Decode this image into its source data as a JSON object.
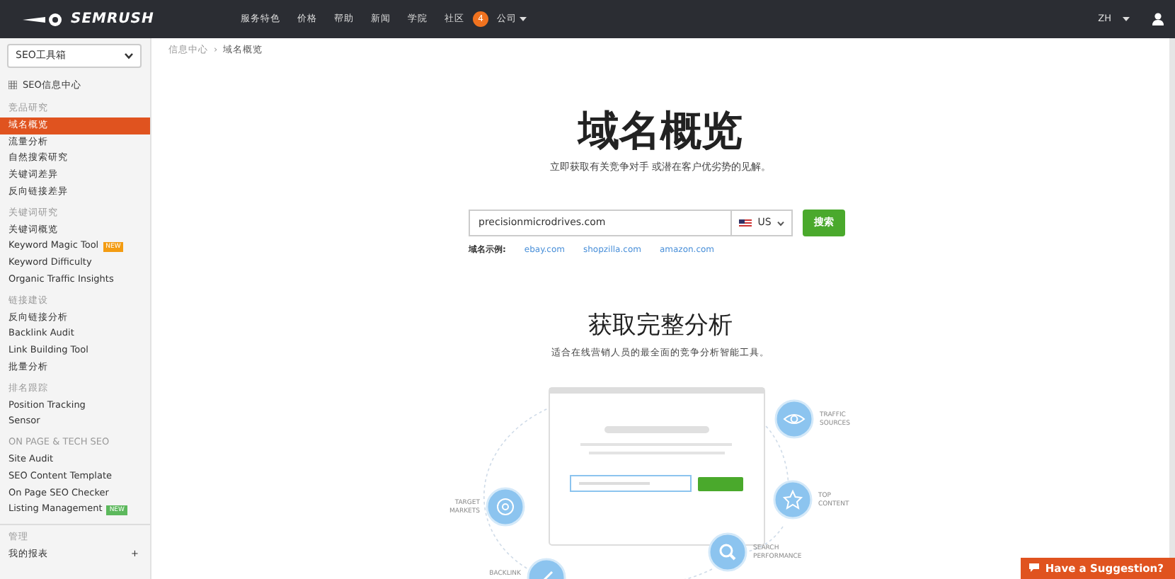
{
  "topbar": {
    "logo": "SEMRUSH",
    "nav": [
      {
        "label": "服务特色"
      },
      {
        "label": "价格"
      },
      {
        "label": "帮助"
      },
      {
        "label": "新闻"
      },
      {
        "label": "学院"
      },
      {
        "label": "社区",
        "badge": "4"
      },
      {
        "label": "公司",
        "dropdown": true
      }
    ],
    "language": "ZH",
    "language_dropdown": true
  },
  "sidebar": {
    "selector": "SEO工具箱",
    "items": [
      {
        "kind": "home",
        "label": "SEO信息中心"
      },
      {
        "kind": "section",
        "label": "竞品研究"
      },
      {
        "kind": "item",
        "label": "域名概览",
        "selected": true
      },
      {
        "kind": "item",
        "label": "流量分析",
        "selected": false
      },
      {
        "kind": "item",
        "label": "自然搜索研究",
        "selected": false
      },
      {
        "kind": "item",
        "label": "关键词差异",
        "selected": false
      },
      {
        "kind": "item",
        "label": "反向链接差异",
        "selected": false
      },
      {
        "kind": "section",
        "label": "关键词研究"
      },
      {
        "kind": "item",
        "label": "关键词概览",
        "selected": false
      },
      {
        "kind": "item",
        "label": "Keyword Magic Tool",
        "selected": false,
        "badge": "NEW",
        "color": "#f39c12"
      },
      {
        "kind": "item",
        "label": "Keyword Difficulty",
        "selected": false
      },
      {
        "kind": "item",
        "label": "Organic Traffic Insights",
        "selected": false
      },
      {
        "kind": "section",
        "label": "链接建设"
      },
      {
        "kind": "item",
        "label": "反向链接分析",
        "selected": false
      },
      {
        "kind": "item",
        "label": "Backlink Audit",
        "selected": false
      },
      {
        "kind": "item",
        "label": "Link Building Tool",
        "selected": false
      },
      {
        "kind": "item",
        "label": "批量分析",
        "selected": false
      },
      {
        "kind": "section",
        "label": "排名跟踪"
      },
      {
        "kind": "item",
        "label": "Position Tracking",
        "selected": false
      },
      {
        "kind": "item",
        "label": "Sensor",
        "selected": false
      },
      {
        "kind": "section",
        "label": "ON PAGE & TECH SEO"
      },
      {
        "kind": "item",
        "label": "Site Audit",
        "selected": false
      },
      {
        "kind": "item",
        "label": "SEO Content Template",
        "selected": false
      },
      {
        "kind": "item",
        "label": "On Page SEO Checker",
        "selected": false
      },
      {
        "kind": "item",
        "label": "Listing Management",
        "selected": false,
        "badge": "NEW",
        "color": "#5cb85c"
      },
      {
        "kind": "divider"
      },
      {
        "kind": "section",
        "label": "管理"
      },
      {
        "kind": "add",
        "label": "我的报表",
        "action": "+"
      }
    ]
  },
  "breadcrumb": [
    {
      "label": "信息中心"
    },
    {
      "label": "域名概览"
    }
  ],
  "breadcrumb_separator": "›",
  "hero": {
    "title": "域名概览",
    "subtitle": "立即获取有关竞争对手 或潜在客户优劣势的见解。"
  },
  "search": {
    "value": "precisionmicrodrives.com",
    "country": "US",
    "button": "搜索"
  },
  "examples": {
    "label": "域名示例:",
    "links": [
      "ebay.com",
      "shopzilla.com",
      "amazon.com"
    ]
  },
  "features": {
    "title": "获取完整分析",
    "subtitle": "适合在线营销人员的最全面的竞争分析智能工具。",
    "labels": [
      {
        "kind": "eye",
        "lines": [
          "TRAFFIC",
          "SOURCES"
        ]
      },
      {
        "kind": "star",
        "lines": [
          "TOP",
          "CONTENT"
        ]
      },
      {
        "kind": "target",
        "lines": [
          "TARGET",
          "MARKETS"
        ]
      },
      {
        "kind": "search",
        "lines": [
          "SEARCH",
          "PERFORMANCE"
        ]
      },
      {
        "kind": "link",
        "lines": [
          "BACKLINK"
        ]
      }
    ]
  },
  "suggestion": "Have a Suggestion?"
}
